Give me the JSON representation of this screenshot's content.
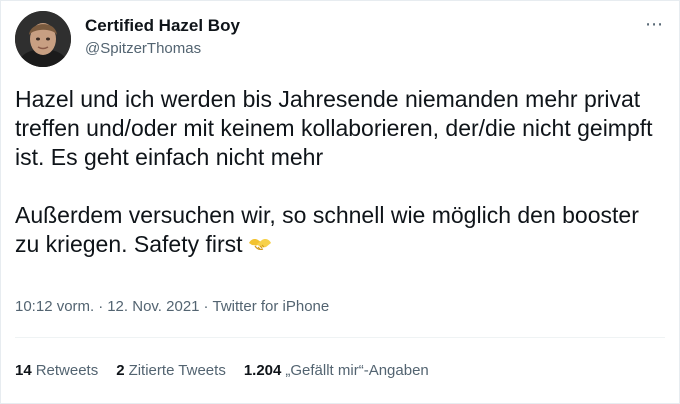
{
  "tweet": {
    "display_name": "Certified Hazel Boy",
    "handle": "@SpitzerThomas",
    "more_icon": "⋯",
    "paragraphs": [
      "Hazel und ich werden bis Jahresende niemanden mehr privat treffen und/oder mit keinem kollaborieren, der/die nicht geimpft ist. Es geht einfach nicht mehr",
      "Außerdem versuchen wir, so schnell wie möglich den booster zu kriegen. Safety first"
    ],
    "emoji": "handshake-emoji",
    "time": "10:12 vorm.",
    "separator": "·",
    "date": "12. Nov. 2021",
    "source": "Twitter for iPhone"
  },
  "stats": {
    "retweets_count": "14",
    "retweets_label": "Retweets",
    "quotes_count": "2",
    "quotes_label": "Zitierte Tweets",
    "likes_count": "1.204",
    "likes_label": "„Gefällt mir“-Angaben"
  },
  "colors": {
    "text_primary": "#0f1419",
    "text_secondary": "#536471",
    "divider": "#eff3f4",
    "background": "#ffffff"
  }
}
